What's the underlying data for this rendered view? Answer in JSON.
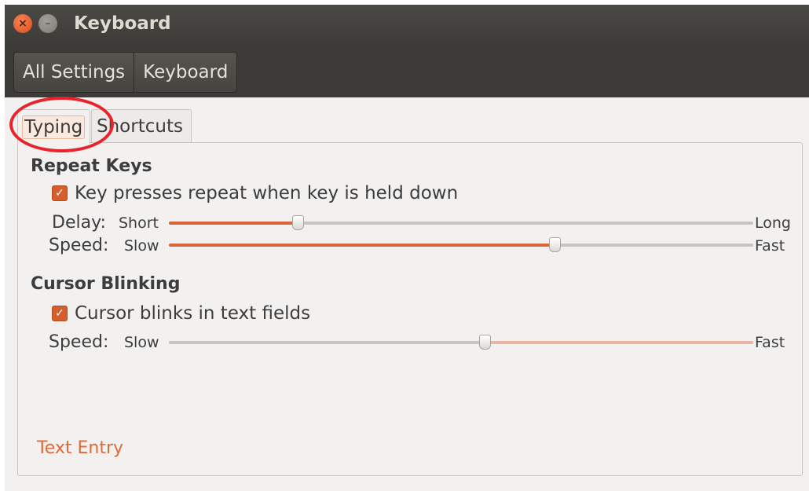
{
  "window": {
    "title": "Keyboard",
    "close_glyph": "×",
    "minimize_glyph": "–"
  },
  "breadcrumb": {
    "items": [
      "All Settings",
      "Keyboard"
    ]
  },
  "tabs": [
    {
      "label": "Typing",
      "selected": true
    },
    {
      "label": "Shortcuts",
      "selected": false
    }
  ],
  "repeat_keys": {
    "heading": "Repeat Keys",
    "checkbox_label": "Key presses repeat when key is held down",
    "checked": true,
    "delay": {
      "label": "Delay:",
      "min_label": "Short",
      "max_label": "Long",
      "value": 0.22
    },
    "speed": {
      "label": "Speed:",
      "min_label": "Slow",
      "max_label": "Fast",
      "value": 0.66
    }
  },
  "cursor_blinking": {
    "heading": "Cursor Blinking",
    "checkbox_label": "Cursor blinks in text fields",
    "checked": true,
    "speed": {
      "label": "Speed:",
      "min_label": "Slow",
      "max_label": "Fast",
      "value": 0.54
    }
  },
  "text_entry_link": "Text Entry",
  "colors": {
    "accent": "#dd4814",
    "slider_fill": "#d8663a",
    "link": "#e06a37",
    "annotation": "#e8232c"
  }
}
